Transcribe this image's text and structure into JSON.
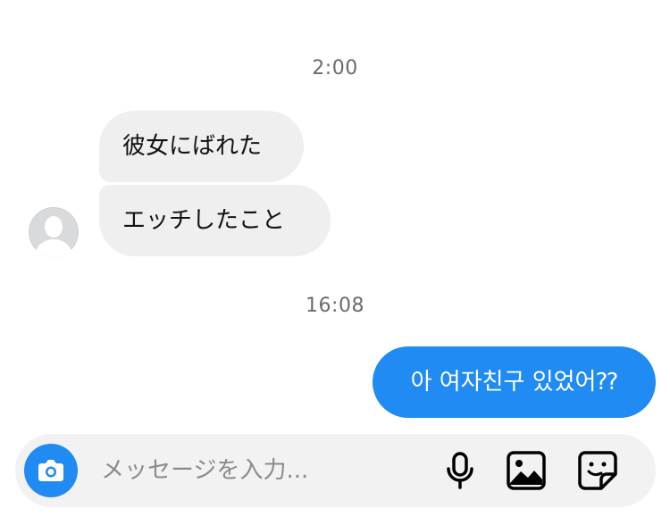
{
  "conversation": {
    "groups": [
      {
        "timestamp": "2:00",
        "incoming": [
          "彼女にばれた",
          "エッチしたこと"
        ]
      },
      {
        "timestamp": "16:08",
        "outgoing": [
          "아 여자친구 있었어⁇"
        ]
      }
    ]
  },
  "composer": {
    "placeholder": "メッセージを入力..."
  },
  "icons": {
    "avatar": "person-placeholder-icon",
    "camera": "camera-icon",
    "mic": "microphone-icon",
    "gallery": "image-gallery-icon",
    "sticker": "sticker-icon"
  },
  "colors": {
    "accent": "#1f8bf3",
    "incoming_bubble": "#efeff0",
    "composer_bg": "#f2f2f3",
    "timestamp_text": "#6b6b6f"
  }
}
